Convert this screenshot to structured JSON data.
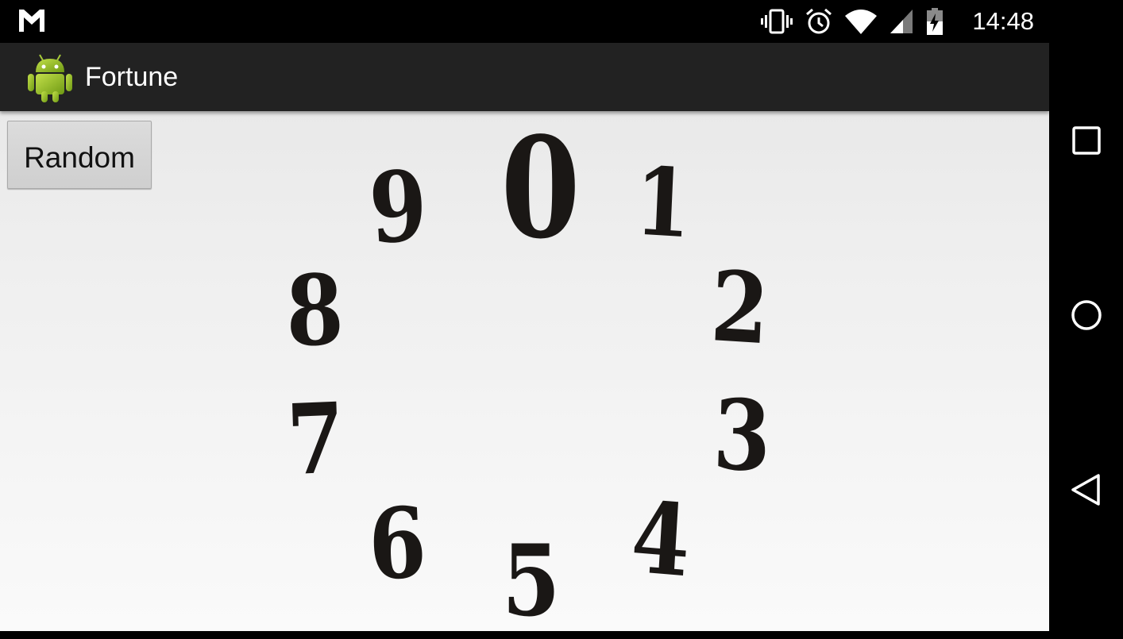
{
  "status_bar": {
    "time": "14:48",
    "icons": [
      "gmail-icon",
      "vibrate-icon",
      "alarm-icon",
      "wifi-icon",
      "signal-icon",
      "battery-charging-icon"
    ]
  },
  "action_bar": {
    "title": "Fortune",
    "app_icon": "android-robot-icon"
  },
  "random_button": {
    "label": "Random"
  },
  "wheel": {
    "digits": [
      "0",
      "1",
      "2",
      "3",
      "4",
      "5",
      "6",
      "7",
      "8",
      "9"
    ]
  },
  "nav_bar": {
    "buttons": [
      "recents-icon",
      "home-icon",
      "back-icon"
    ]
  },
  "colors": {
    "status_bar": "#000000",
    "action_bar": "#222222",
    "digit": "#1a1715",
    "button": "#d4d4d4",
    "android_green": "#97c024"
  }
}
